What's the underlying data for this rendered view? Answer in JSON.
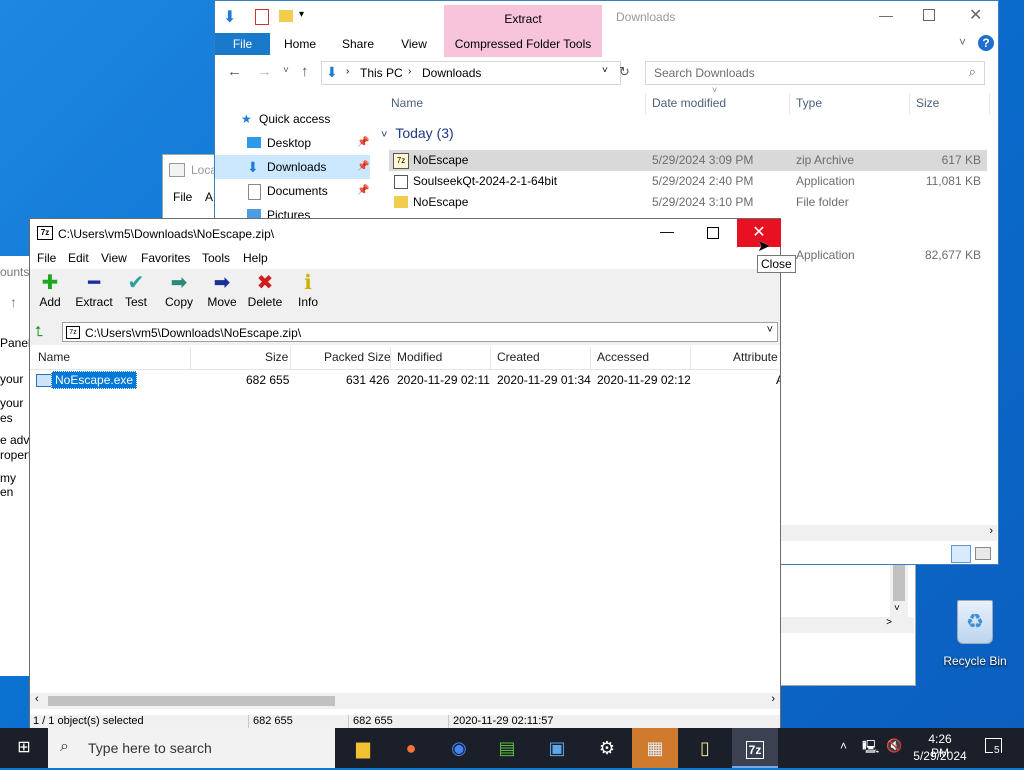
{
  "explorer": {
    "title": "Downloads",
    "ribbon": {
      "context_group": "Extract",
      "tabs": [
        "File",
        "Home",
        "Share",
        "View",
        "Compressed Folder Tools"
      ]
    },
    "breadcrumb": [
      "This PC",
      "Downloads"
    ],
    "search_placeholder": "Search Downloads",
    "nav": {
      "quick_access": "Quick access",
      "items": [
        "Desktop",
        "Downloads",
        "Documents",
        "Pictures"
      ]
    },
    "columns": [
      "Name",
      "Date modified",
      "Type",
      "Size"
    ],
    "group_header": "Today (3)",
    "rows": [
      {
        "name": "NoEscape",
        "date": "5/29/2024 3:09 PM",
        "type": "zip Archive",
        "size": "617 KB"
      },
      {
        "name": "SoulseekQt-2024-2-1-64bit",
        "date": "5/29/2024 2:40 PM",
        "type": "Application",
        "size": "11,081 KB"
      },
      {
        "name": "NoEscape",
        "date": "5/29/2024 3:10 PM",
        "type": "File folder",
        "size": ""
      },
      {
        "name": "",
        "date": "",
        "type": "Application",
        "size": "82,677 KB"
      }
    ]
  },
  "bg_window": {
    "title_fragment": "Loca",
    "menu_file": "File",
    "menu_a": "A",
    "side_texts": [
      "ounts",
      "Panel",
      "your",
      "your",
      "es",
      "e adv",
      "ropert",
      "my en"
    ]
  },
  "zip": {
    "title": "C:\\Users\\vm5\\Downloads\\NoEscape.zip\\",
    "menu": [
      "File",
      "Edit",
      "View",
      "Favorites",
      "Tools",
      "Help"
    ],
    "toolbar": [
      {
        "label": "Add",
        "icon": "plus-icon",
        "color": "#1fa51f"
      },
      {
        "label": "Extract",
        "icon": "minus-icon",
        "color": "#1a2e9c"
      },
      {
        "label": "Test",
        "icon": "check-icon",
        "color": "#2aa0a0"
      },
      {
        "label": "Copy",
        "icon": "copy-arrow-icon",
        "color": "#2a8a7a"
      },
      {
        "label": "Move",
        "icon": "move-arrow-icon",
        "color": "#1a2e9c"
      },
      {
        "label": "Delete",
        "icon": "delete-x-icon",
        "color": "#d21b1b"
      },
      {
        "label": "Info",
        "icon": "info-icon",
        "color": "#c8b400"
      }
    ],
    "path": "C:\\Users\\vm5\\Downloads\\NoEscape.zip\\",
    "columns": [
      "Name",
      "Size",
      "Packed Size",
      "Modified",
      "Created",
      "Accessed",
      "Attribute"
    ],
    "rows": [
      {
        "name": "NoEscape.exe",
        "size": "682 655",
        "packed": "631 426",
        "modified": "2020-11-29 02:11",
        "created": "2020-11-29 01:34",
        "accessed": "2020-11-29 02:12",
        "attr": "A"
      }
    ],
    "status": {
      "selected": "1 / 1 object(s) selected",
      "size": "682 655",
      "packed": "682 655",
      "date": "2020-11-29 02:11:57"
    },
    "close_tooltip": "Close"
  },
  "desktop": {
    "recycle_bin": "Recycle Bin"
  },
  "taskbar": {
    "search_placeholder": "Type here to search",
    "time": "4:26 PM",
    "date": "5/29/2024",
    "notification_count": "5",
    "active_app": "7z"
  }
}
